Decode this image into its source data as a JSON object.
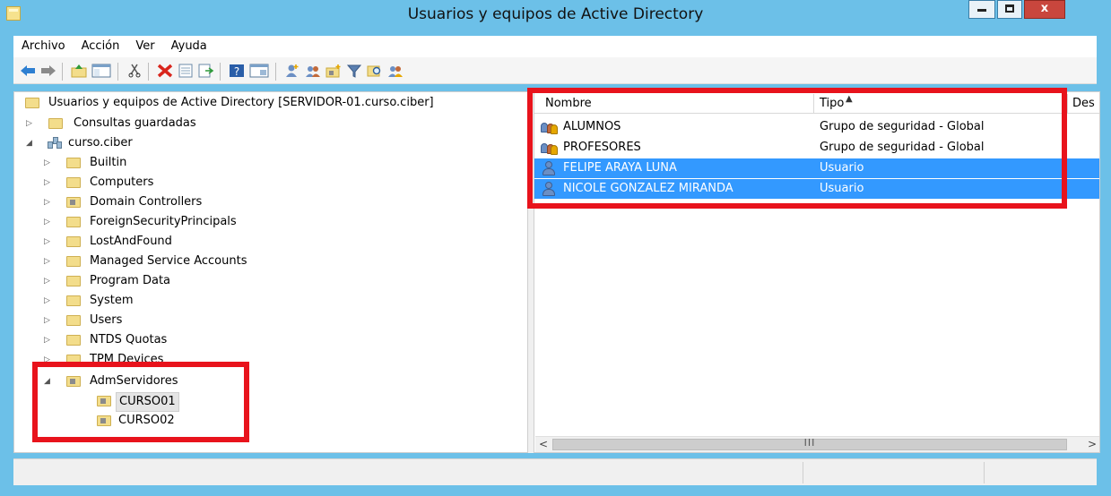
{
  "window": {
    "title": "Usuarios y equipos de Active Directory",
    "close_glyph": "x"
  },
  "menu": [
    "Archivo",
    "Acción",
    "Ver",
    "Ayuda"
  ],
  "toolbar": {
    "icons": [
      "back-icon",
      "forward-icon",
      "up-folder-icon",
      "show-tree-icon",
      "cut-icon",
      "delete-icon",
      "properties-icon",
      "export-list-icon",
      "help-icon",
      "console-icon",
      "new-user-icon",
      "new-group-icon",
      "new-ou-icon",
      "filter-icon",
      "find-icon",
      "add-to-group-icon"
    ]
  },
  "tree": {
    "root": "Usuarios y equipos de Active Directory [SERVIDOR-01.curso.ciber]",
    "saved_queries": "Consultas guardadas",
    "domain": "curso.ciber",
    "children": [
      {
        "label": "Builtin",
        "type": "folder"
      },
      {
        "label": "Computers",
        "type": "folder"
      },
      {
        "label": "Domain Controllers",
        "type": "ou"
      },
      {
        "label": "ForeignSecurityPrincipals",
        "type": "folder"
      },
      {
        "label": "LostAndFound",
        "type": "folder"
      },
      {
        "label": "Managed Service Accounts",
        "type": "folder"
      },
      {
        "label": "Program Data",
        "type": "folder"
      },
      {
        "label": "System",
        "type": "folder"
      },
      {
        "label": "Users",
        "type": "folder"
      },
      {
        "label": "NTDS Quotas",
        "type": "folder"
      },
      {
        "label": "TPM Devices",
        "type": "folder"
      }
    ],
    "adm": {
      "label": "AdmServidores",
      "children": [
        "CURSO01",
        "CURSO02"
      ]
    }
  },
  "list": {
    "columns": [
      "Nombre",
      "Tipo",
      "Des"
    ],
    "rows": [
      {
        "name": "ALUMNOS",
        "type": "Grupo de seguridad - Global",
        "icon": "group-icon",
        "selected": false
      },
      {
        "name": "PROFESORES",
        "type": "Grupo de seguridad - Global",
        "icon": "group-icon",
        "selected": false
      },
      {
        "name": "FELIPE ARAYA LUNA",
        "type": "Usuario",
        "icon": "user-icon",
        "selected": true
      },
      {
        "name": "NICOLE GONZALEZ MIRANDA",
        "type": "Usuario",
        "icon": "user-icon",
        "selected": true
      }
    ],
    "scroll_grip": "III"
  },
  "colors": {
    "titlebar": "#6cc0e8",
    "selection": "#3399ff",
    "annotation": "#e8131c"
  }
}
